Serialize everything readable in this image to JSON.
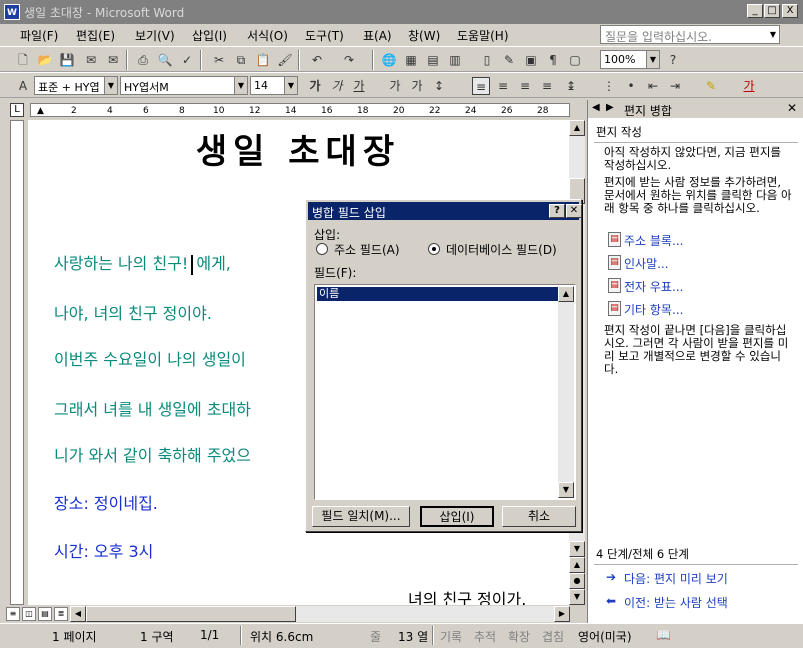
{
  "window": {
    "title": "생일 초대장 - Microsoft Word",
    "app_icon": "W",
    "minimize": "_",
    "maximize": "□",
    "close": "X"
  },
  "menu": {
    "items": [
      "파일(F)",
      "편집(E)",
      "보기(V)",
      "삽입(I)",
      "서식(O)",
      "도구(T)",
      "표(A)",
      "창(W)",
      "도움말(H)"
    ],
    "help_placeholder": "질문을 입력하십시오."
  },
  "toolbar": {
    "zoom": "100%",
    "style": "표준 + HY엽",
    "font": "HY엽서M",
    "size": "14"
  },
  "document": {
    "title": "생일 초대장",
    "lines": [
      "사랑하는 나의 친구!",
      "에게,",
      "나야, 녀의 친구 정이야.",
      "이번주 수요일이 나의 생일이",
      "그래서 녀를 내 생일에 초대하",
      "니가 와서 같이 축하해 주었으",
      "장소: 정이네집.",
      "시간: 오후 3시",
      "녀의 친구 정이가."
    ]
  },
  "dialog": {
    "title": "병합 필드 삽입",
    "insert_label": "삽입:",
    "radio_address": "주소 필드(A)",
    "radio_database": "데이터베이스 필드(D)",
    "selected_radio": "database",
    "fields_label": "필드(F):",
    "fields": [
      "이름"
    ],
    "btn_match": "필드 일치(M)...",
    "btn_insert": "삽입(I)",
    "btn_cancel": "취소"
  },
  "taskpane": {
    "title": "편지 병합",
    "section": "편지 작성",
    "p1": "아직 작성하지 않았다면, 지금 편지를 작성하십시오.",
    "p2": "편지에 받는 사람 정보를 추가하려면, 문서에서 원하는 위치를 클릭한 다음 아래 항목 중 하나를 클릭하십시오.",
    "links": [
      "주소 블록...",
      "인사말...",
      "전자 우표...",
      "기타 항목..."
    ],
    "p3": "편지 작성이 끝나면 [다음]을 클릭하십시오. 그러면 각 사람이 받을 편지를 미리 보고 개별적으로 변경할 수 있습니다.",
    "step": "4 단계/전체 6 단계",
    "next": "다음: 편지 미리 보기",
    "prev": "이전: 받는 사람 선택"
  },
  "status": {
    "page": "1 페이지",
    "section": "1 구역",
    "pages": "1/1",
    "position": "위치 6.6cm",
    "line": "줄",
    "col": "13 열",
    "rec": "기록",
    "trk": "추적",
    "ext": "확장",
    "ovr": "겹침",
    "lang": "영어(미국)"
  }
}
